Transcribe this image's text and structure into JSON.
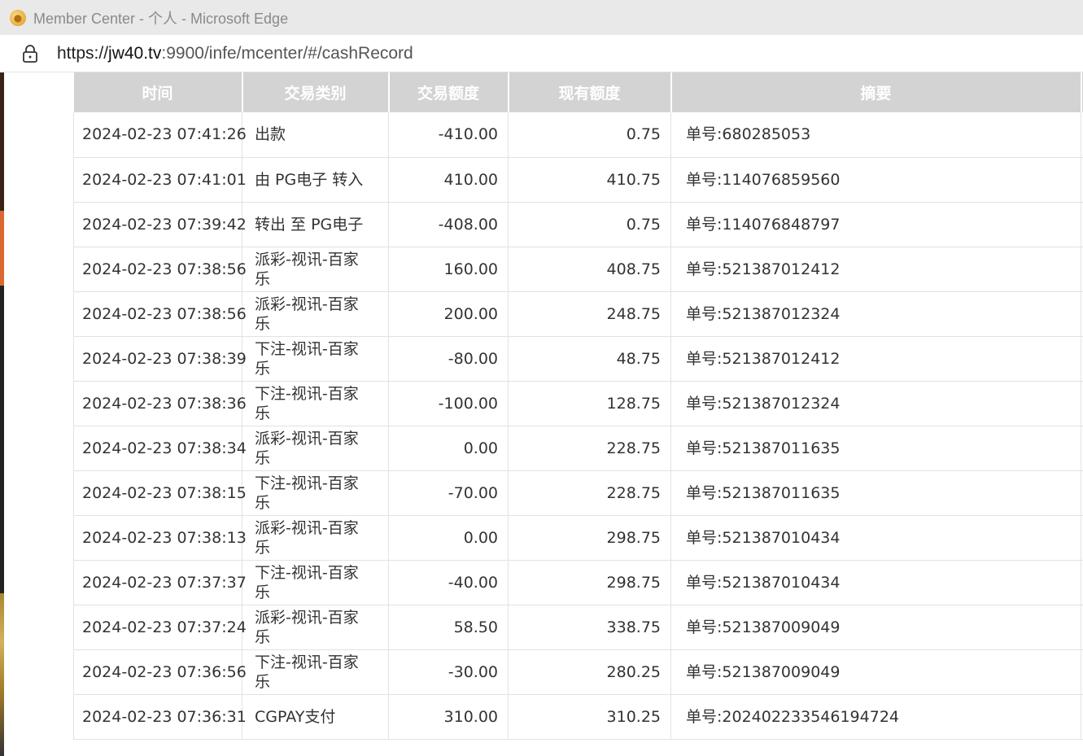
{
  "window": {
    "title": "Member Center - 个人 - Microsoft Edge"
  },
  "address_bar": {
    "url_scheme": "https://",
    "url_host": "jw40.tv",
    "url_rest": ":9900/infe/mcenter/#/cashRecord"
  },
  "table": {
    "headers": [
      "时间",
      "交易类别",
      "交易额度",
      "现有额度",
      "摘要"
    ],
    "rows": [
      {
        "time": "2024-02-23 07:41:26",
        "type": "出款",
        "amount": "-410.00",
        "balance": "0.75",
        "summary": "单号:680285053"
      },
      {
        "time": "2024-02-23 07:41:01",
        "type": "由 PG电子 转入",
        "amount": "410.00",
        "balance": "410.75",
        "summary": "单号:114076859560"
      },
      {
        "time": "2024-02-23 07:39:42",
        "type": "转出 至 PG电子",
        "amount": "-408.00",
        "balance": "0.75",
        "summary": "单号:114076848797"
      },
      {
        "time": "2024-02-23 07:38:56",
        "type": "派彩-视讯-百家乐",
        "amount": "160.00",
        "balance": "408.75",
        "summary": "单号:521387012412"
      },
      {
        "time": "2024-02-23 07:38:56",
        "type": "派彩-视讯-百家乐",
        "amount": "200.00",
        "balance": "248.75",
        "summary": "单号:521387012324"
      },
      {
        "time": "2024-02-23 07:38:39",
        "type": "下注-视讯-百家乐",
        "amount": "-80.00",
        "balance": "48.75",
        "summary": "单号:521387012412"
      },
      {
        "time": "2024-02-23 07:38:36",
        "type": "下注-视讯-百家乐",
        "amount": "-100.00",
        "balance": "128.75",
        "summary": "单号:521387012324"
      },
      {
        "time": "2024-02-23 07:38:34",
        "type": "派彩-视讯-百家乐",
        "amount": "0.00",
        "balance": "228.75",
        "summary": "单号:521387011635"
      },
      {
        "time": "2024-02-23 07:38:15",
        "type": "下注-视讯-百家乐",
        "amount": "-70.00",
        "balance": "228.75",
        "summary": "单号:521387011635"
      },
      {
        "time": "2024-02-23 07:38:13",
        "type": "派彩-视讯-百家乐",
        "amount": "0.00",
        "balance": "298.75",
        "summary": "单号:521387010434"
      },
      {
        "time": "2024-02-23 07:37:37",
        "type": "下注-视讯-百家乐",
        "amount": "-40.00",
        "balance": "298.75",
        "summary": "单号:521387010434"
      },
      {
        "time": "2024-02-23 07:37:24",
        "type": "派彩-视讯-百家乐",
        "amount": "58.50",
        "balance": "338.75",
        "summary": "单号:521387009049"
      },
      {
        "time": "2024-02-23 07:36:56",
        "type": "下注-视讯-百家乐",
        "amount": "-30.00",
        "balance": "280.25",
        "summary": "单号:521387009049"
      },
      {
        "time": "2024-02-23 07:36:31",
        "type": "CGPAY支付",
        "amount": "310.00",
        "balance": "310.25",
        "summary": "单号:202402233546194724"
      }
    ]
  },
  "icons": {
    "app": "browser-favicon",
    "lock": "lock-icon"
  }
}
